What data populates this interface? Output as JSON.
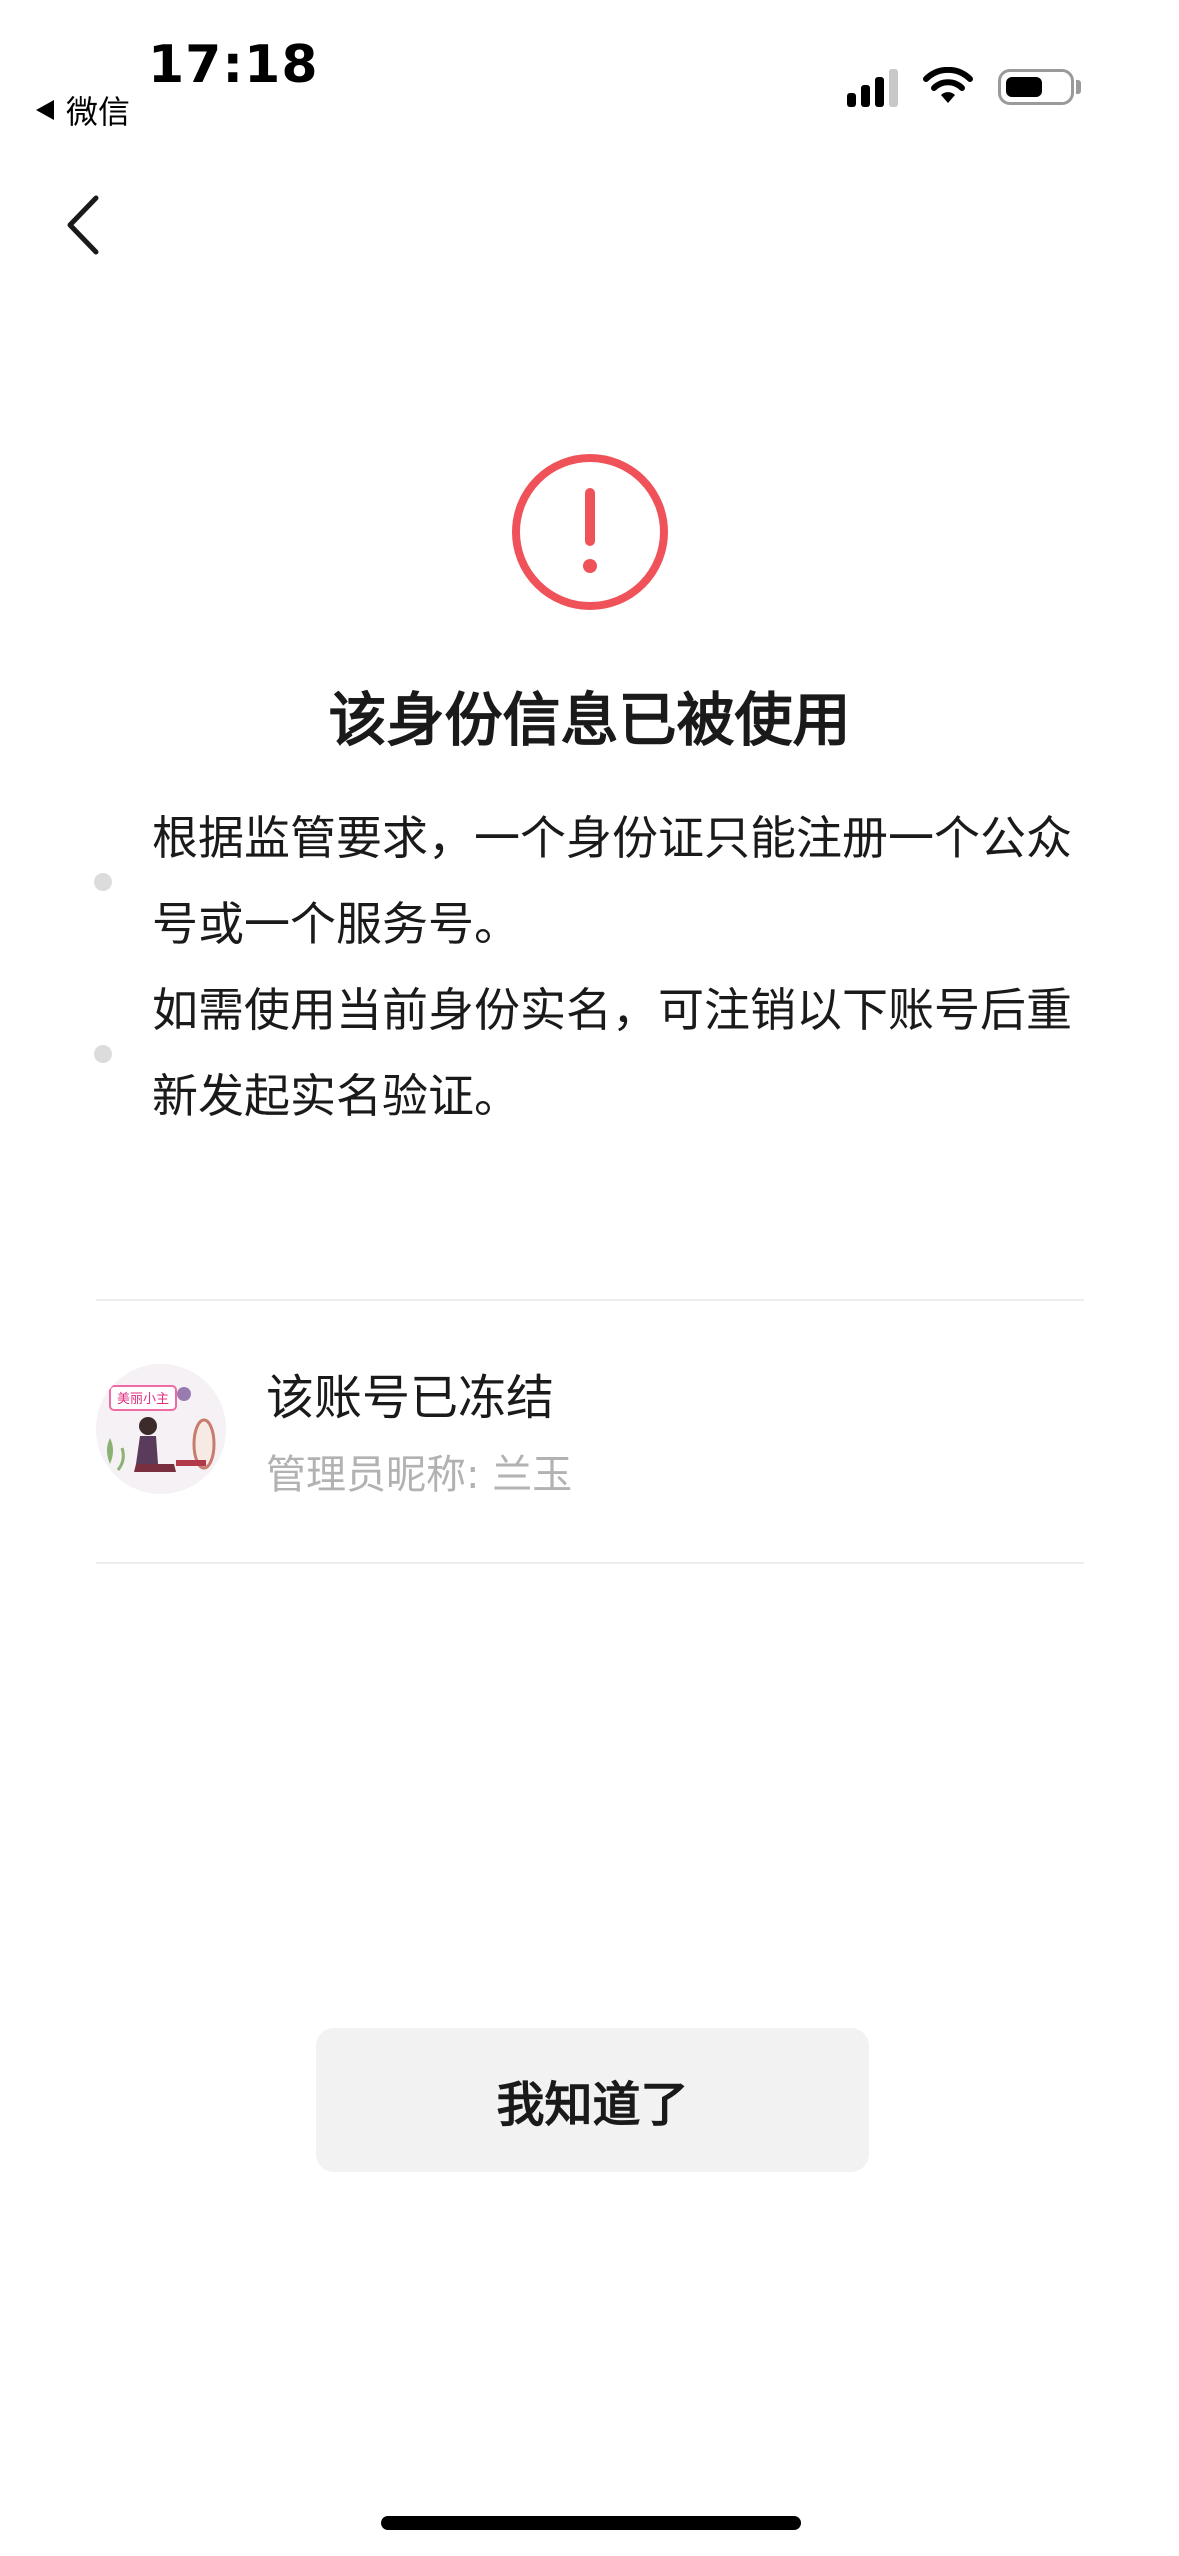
{
  "status_bar": {
    "time": "17:18",
    "back_app": "微信",
    "icons": [
      "signal-icon",
      "wifi-icon",
      "battery-icon"
    ]
  },
  "nav": {
    "back_icon": "chevron-left-icon"
  },
  "alert": {
    "icon": "exclamation-circle-icon",
    "color": "#f0525a",
    "title": "该身份信息已被使用"
  },
  "notes": [
    {
      "text": "根据监管要求，一个身份证只能注册一个公众号或一个服务号。"
    },
    {
      "text": "如需使用当前身份实名，可注销以下账号后重新发起实名验证。"
    }
  ],
  "account": {
    "avatar_text": "美丽小主",
    "name": "该账号已冻结",
    "admin": "管理员昵称: 兰玉"
  },
  "confirm_button": {
    "label": "我知道了"
  }
}
